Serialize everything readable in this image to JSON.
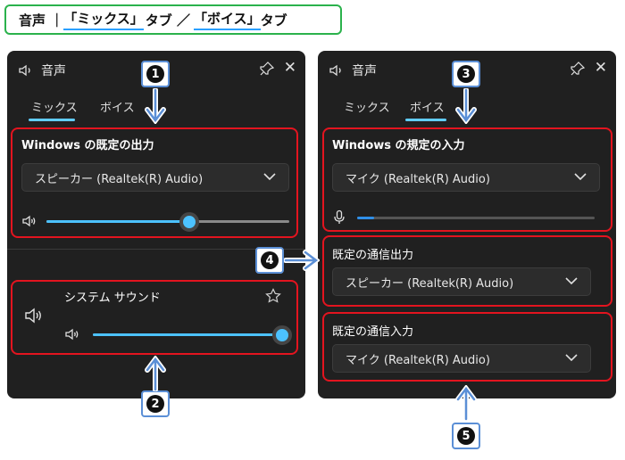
{
  "heading": {
    "prefix": "音声 ｜",
    "mix_part": "「ミックス」",
    "mid": "タブ ／",
    "voice_part": "「ボイス」",
    "suffix": "タブ"
  },
  "left_panel": {
    "title": "音声",
    "tabs": [
      {
        "label": "ミックス"
      },
      {
        "label": "ボイス"
      }
    ],
    "selected_tab": "ミックス",
    "output_section": {
      "title": "Windows の既定の出力",
      "device": "スピーカー (Realtek(R) Audio)",
      "volume": 0.59
    },
    "system_sound": {
      "label": "システム サウンド",
      "volume": 1.0
    }
  },
  "right_panel": {
    "title": "音声",
    "tabs": [
      {
        "label": "ミックス"
      },
      {
        "label": "ボイス"
      }
    ],
    "selected_tab": "ボイス",
    "input_section": {
      "title": "Windows の規定の入力",
      "device": "マイク (Realtek(R) Audio)",
      "level": 0.07
    },
    "comm_output": {
      "title": "既定の通信出力",
      "device": "スピーカー (Realtek(R) Audio)"
    },
    "comm_input": {
      "title": "既定の通信入力",
      "device": "マイク (Realtek(R) Audio)"
    }
  },
  "callouts": [
    "1",
    "2",
    "3",
    "4",
    "5"
  ],
  "colors": {
    "accent": "#4cc2ff",
    "highlight": "#e3141f",
    "panel_bg": "#202020",
    "frame": "#2bb24c"
  }
}
